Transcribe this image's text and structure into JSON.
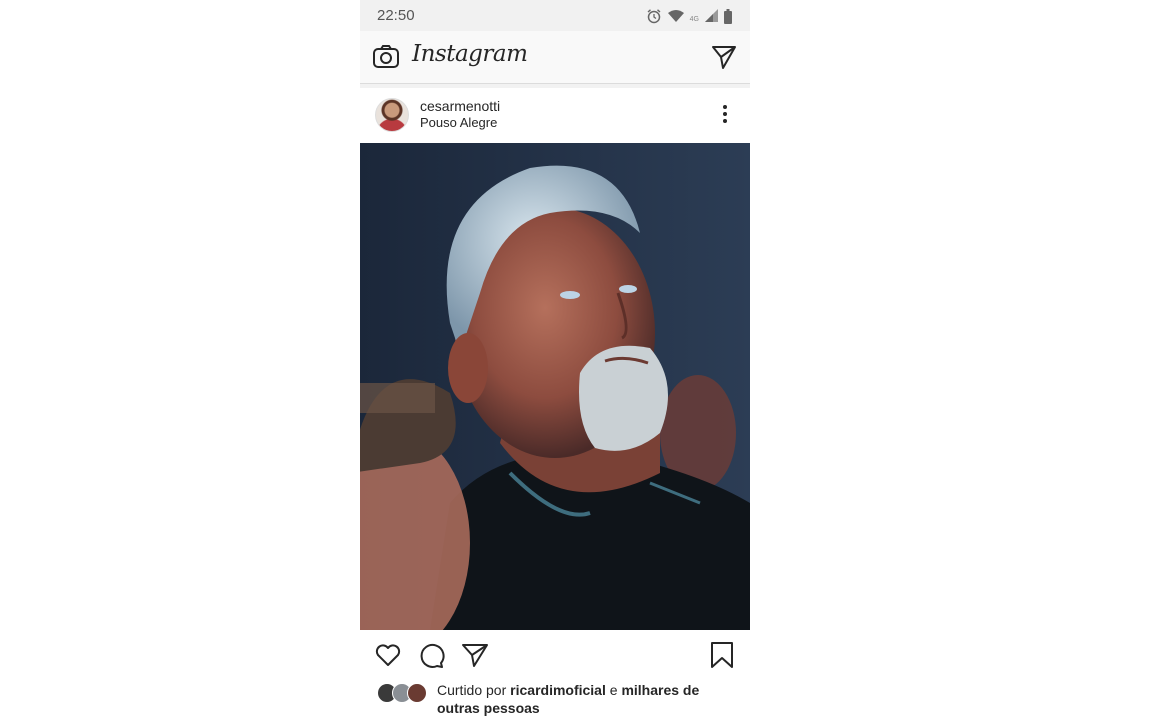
{
  "status_bar": {
    "time": "22:50",
    "network": "4G",
    "icons": [
      "alarm-icon",
      "wifi-icon",
      "signal-icon",
      "battery-icon"
    ]
  },
  "app_bar": {
    "title": "Instagram",
    "camera_icon": "camera-icon",
    "direct_icon": "paper-plane-icon"
  },
  "post": {
    "username": "cesarmenotti",
    "location": "Pouso Alegre",
    "image_description": "photo",
    "actions": [
      "heart-icon",
      "comment-icon",
      "share-icon",
      "bookmark-icon"
    ],
    "likes": {
      "prefix": "Curtido por",
      "user": "ricardimoficial",
      "conjunction": "e",
      "others": "milhares de outras pessoas"
    }
  },
  "colors": {
    "text": "#262626",
    "status_bar_bg": "#f1f1f1",
    "photo_bg": "#1a2538"
  }
}
